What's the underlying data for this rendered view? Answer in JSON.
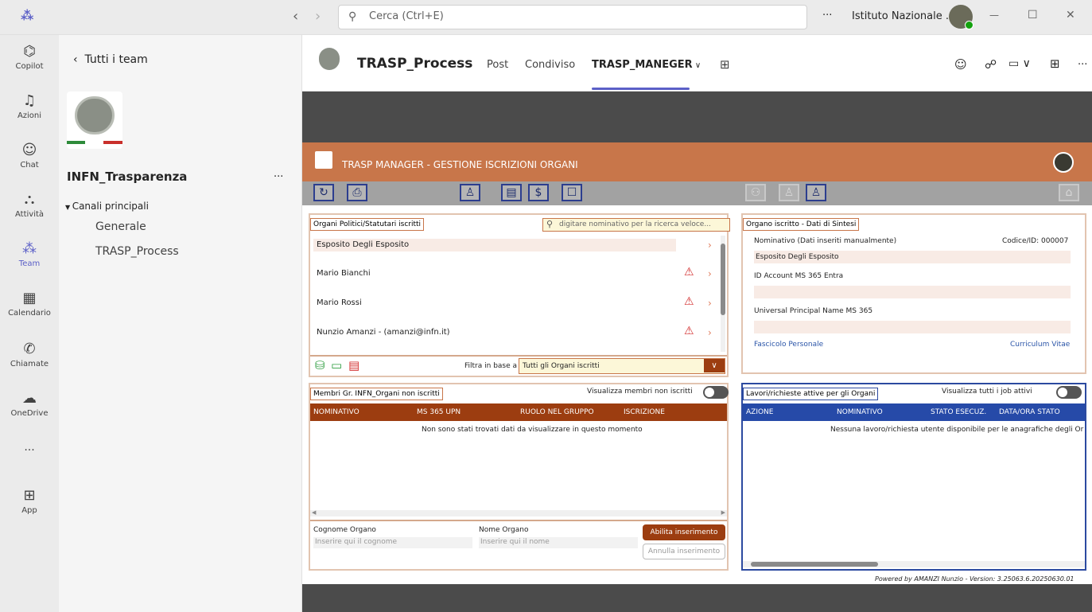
{
  "titlebar": {
    "search_placeholder": "Cerca (Ctrl+E)",
    "more": "···",
    "account": "Istituto Nazionale ...",
    "minimize": "—",
    "maximize": "☐",
    "close": "✕"
  },
  "rail": [
    {
      "label": "Copilot",
      "icon": "copilot-icon"
    },
    {
      "label": "Azioni",
      "icon": "bell-icon"
    },
    {
      "label": "Chat",
      "icon": "chat-icon"
    },
    {
      "label": "Attività",
      "icon": "backpack-icon"
    },
    {
      "label": "Team",
      "icon": "team-icon"
    },
    {
      "label": "Calendario",
      "icon": "calendar-icon"
    },
    {
      "label": "Chiamate",
      "icon": "phone-icon"
    },
    {
      "label": "OneDrive",
      "icon": "cloud-icon"
    },
    {
      "label": "···",
      "icon": "more-icon"
    },
    {
      "label": "App",
      "icon": "add-app-icon"
    }
  ],
  "teampanel": {
    "back": "Tutti i team",
    "team_name": "INFN_Trasparenza",
    "team_more": "···",
    "section": "Canali principali",
    "channels": [
      "Generale",
      "TRASP_Process"
    ]
  },
  "channel": {
    "name": "TRASP_Process",
    "tabs": [
      "Post",
      "Condiviso",
      "TRASP_MANEGER"
    ],
    "active_tab": "TRASP_MANEGER"
  },
  "app": {
    "title": "TRASP MANAGER - GESTIONE ISCRIZIONI ORGANI",
    "left_panel_title": "Organi Politici/Statutari iscritti",
    "search_placeholder": "digitare nominativo per la ricerca veloce...",
    "organs": [
      {
        "name": "Esposito Degli Esposito",
        "warning": false
      },
      {
        "name": "Mario Bianchi",
        "warning": true
      },
      {
        "name": "Mario Rossi",
        "warning": true
      },
      {
        "name": "Nunzio Amanzi - (amanzi@infn.it)",
        "warning": true
      }
    ],
    "filter_label": "Filtra in base a",
    "filter_value": "Tutti gli Organi iscritti",
    "right_panel_title": "Organo iscritto - Dati di Sintesi",
    "nominativo_label": "Nominativo (Dati inseriti manualmente)",
    "codice": "Codice/ID: 000007",
    "nominativo_value": "Esposito Degli Esposito",
    "id_account_label": "ID Account MS 365 Entra",
    "upn_label": "Universal Principal Name MS 365",
    "fascicolo": "Fascicolo Personale",
    "curriculum": "Curriculum Vitae",
    "members_title": "Membri Gr. INFN_Organi non iscritti",
    "members_toggle_label": "Visualizza membri non iscritti",
    "members_columns": [
      "NOMINATIVO",
      "MS 365 UPN",
      "RUOLO NEL GRUPPO",
      "ISCRIZIONE"
    ],
    "members_empty": "Non sono stati trovati dati da visualizzare in questo momento",
    "cognome_label": "Cognome Organo",
    "cognome_placeholder": "Inserire qui il cognome",
    "nome_label": "Nome Organo",
    "nome_placeholder": "Inserire qui il nome",
    "enable_button": "Abilita inserimento",
    "cancel_button": "Annulla inserimento",
    "jobs_title": "Lavori/richieste attive per gli Organi",
    "jobs_toggle_label": "Visualizza tutti i job attivi",
    "jobs_columns": [
      "AZIONE",
      "NOMINATIVO",
      "STATO ESECUZ.",
      "DATA/ORA STATO"
    ],
    "jobs_empty": "Nessuna lavoro/richiesta utente disponibile per le anagrafiche degli Or",
    "footer": "Powered by AMANZI Nunzio - Version: 3.25063.6.20250630.01"
  },
  "colors": {
    "accent": "#5b5fc7",
    "app_header": "#c8764a",
    "table_header": "#9c3d10",
    "jobs_header": "#264aa8"
  }
}
